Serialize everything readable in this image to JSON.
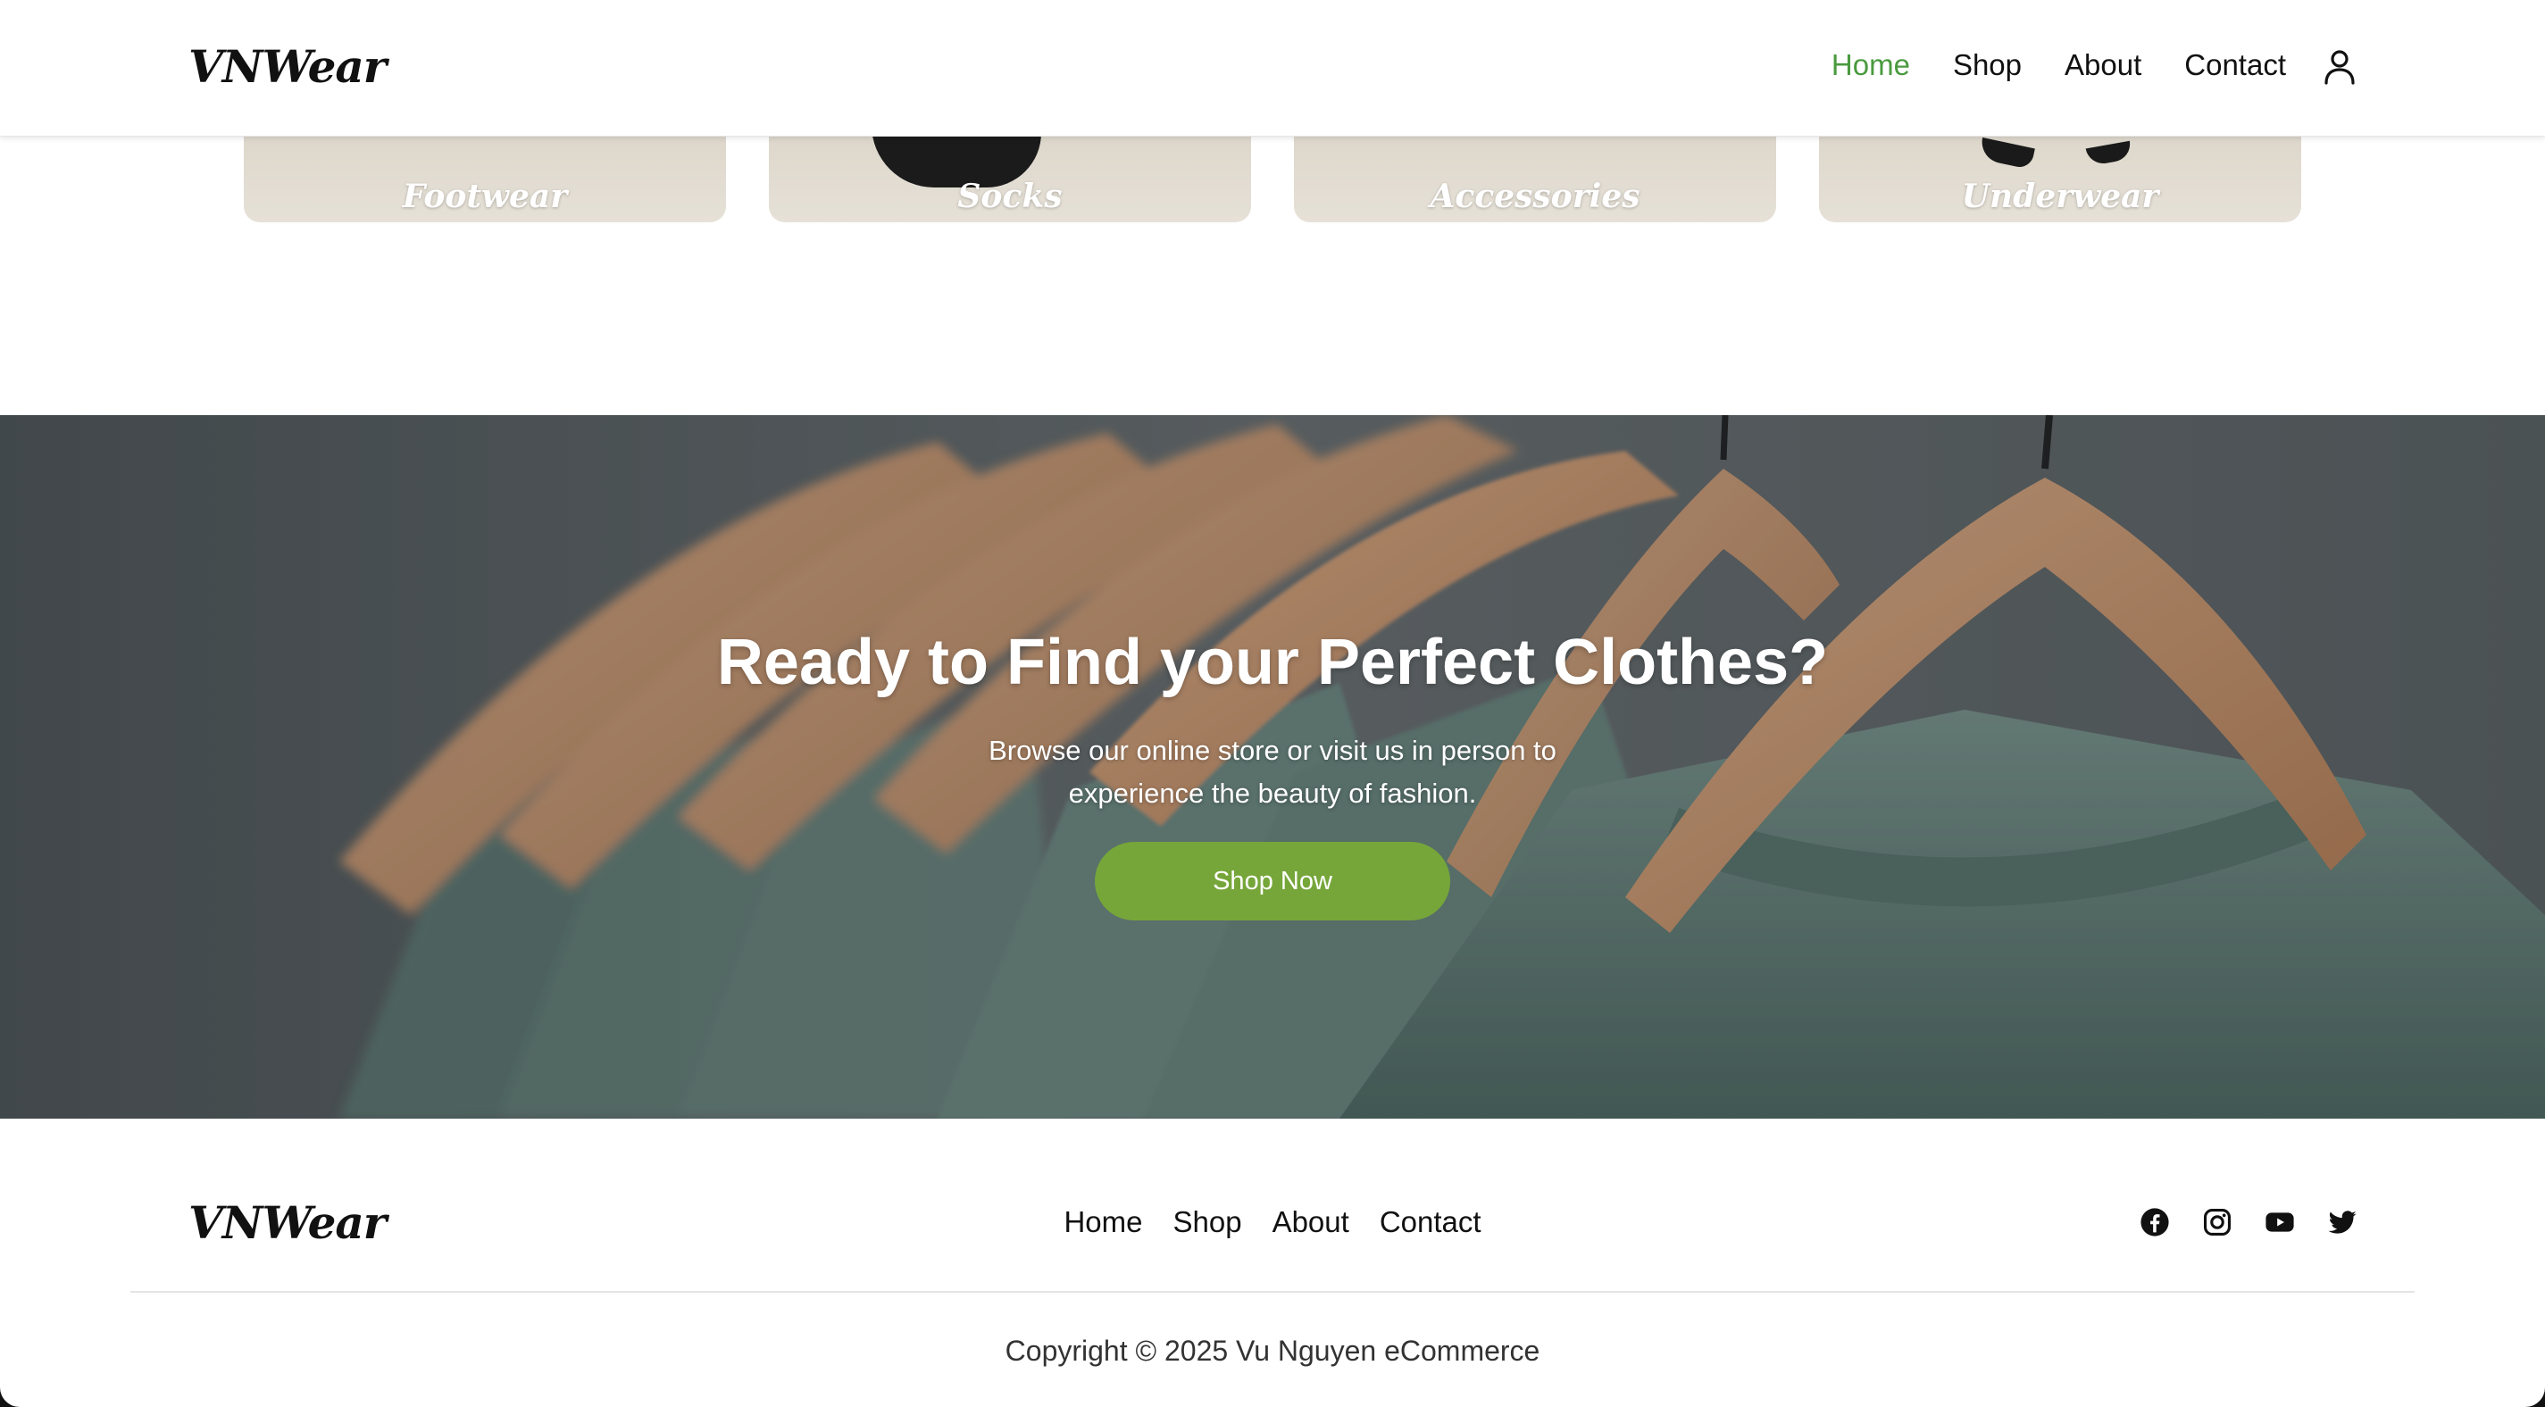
{
  "header": {
    "logo": "VNWear",
    "nav": [
      {
        "label": "Home",
        "active": true
      },
      {
        "label": "Shop",
        "active": false
      },
      {
        "label": "About",
        "active": false
      },
      {
        "label": "Contact",
        "active": false
      }
    ],
    "user_icon": "user-icon"
  },
  "categories": [
    {
      "label": "Footwear"
    },
    {
      "label": "Socks"
    },
    {
      "label": "Accessories"
    },
    {
      "label": "Underwear"
    }
  ],
  "hero": {
    "title": "Ready to Find your Perfect Clothes?",
    "subtitle": "Browse our online store or visit us in person to experience the beauty of fashion.",
    "button_label": "Shop Now"
  },
  "footer": {
    "logo": "VNWear",
    "nav": [
      {
        "label": "Home"
      },
      {
        "label": "Shop"
      },
      {
        "label": "About"
      },
      {
        "label": "Contact"
      }
    ],
    "socials": [
      "facebook-icon",
      "instagram-icon",
      "youtube-icon",
      "twitter-icon"
    ],
    "copyright": "Copyright © 2025 Vu Nguyen eCommerce"
  },
  "colors": {
    "accent_green": "#4a9a3f",
    "button_green": "#76a63a",
    "text_dark": "#111111"
  }
}
